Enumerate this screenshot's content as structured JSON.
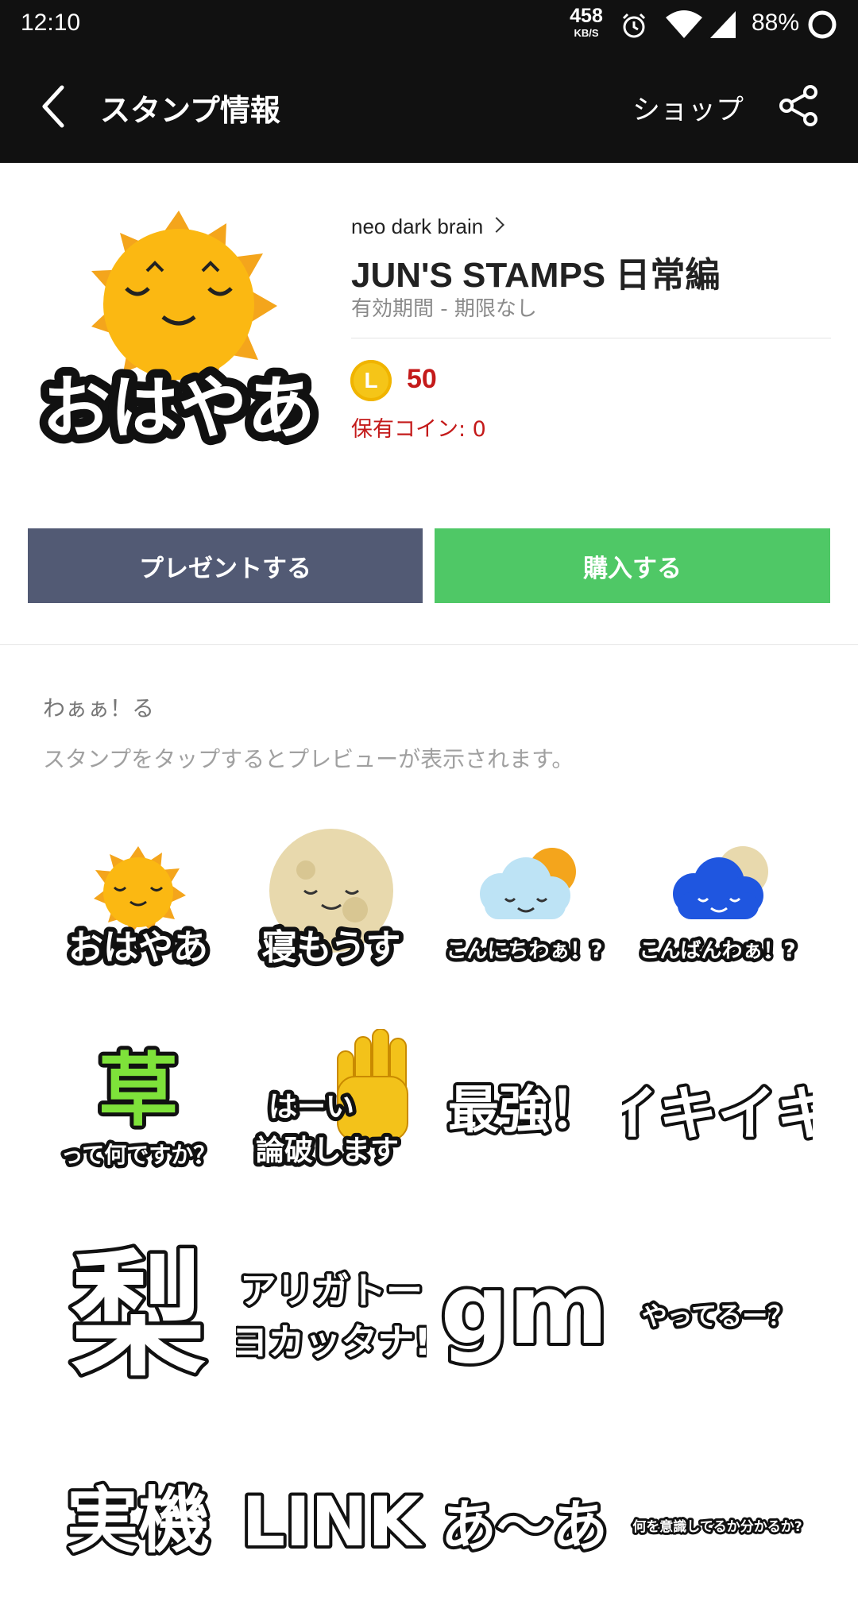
{
  "status_bar": {
    "time": "12:10",
    "net_speed_value": "458",
    "net_speed_unit": "KB/S",
    "battery_pct": "88%"
  },
  "app_bar": {
    "title": "スタンプ情報",
    "shop_label": "ショップ"
  },
  "product": {
    "author": "neo dark brain",
    "name": "JUN'S STAMPS 日常編",
    "validity": "有効期間 - 期限なし",
    "coin_letter": "L",
    "price": "50",
    "owned_coins": "保有コイン: 0",
    "thumbnail_text": "おはやあ"
  },
  "actions": {
    "present_label": "プレゼントする",
    "buy_label": "購入する"
  },
  "description": {
    "tagline": "わぁぁ！る",
    "hint": "スタンプをタップするとプレビューが表示されます。"
  },
  "stickers": [
    {
      "text": "おはやあ",
      "icon": "sun-icon"
    },
    {
      "text": "寝もうす",
      "icon": "moon-icon"
    },
    {
      "text": "こんにちわぁ！?",
      "icon": "cloud-sun-icon"
    },
    {
      "text": "こんばんわぁ！?",
      "icon": "cloud-moon-icon"
    },
    {
      "text": "草",
      "sub": "って何ですか？",
      "icon": "grass-text-icon"
    },
    {
      "text": "はーい",
      "sub": "論破します",
      "icon": "raised-hand-icon"
    },
    {
      "text": "最強！",
      "icon": "text-sticker-icon"
    },
    {
      "text": "イキイキ",
      "icon": "text-sticker-icon"
    },
    {
      "text": "梨",
      "icon": "text-sticker-icon"
    },
    {
      "text": "アリガトー",
      "sub": "ヨカッタナ!",
      "icon": "text-sticker-icon"
    },
    {
      "text": "gm",
      "icon": "text-sticker-icon"
    },
    {
      "text": "やってるー？",
      "icon": "text-sticker-icon"
    },
    {
      "text": "実機",
      "icon": "text-sticker-icon"
    },
    {
      "text": "LINK",
      "icon": "text-sticker-icon"
    },
    {
      "text": "あ〜あ",
      "icon": "text-sticker-icon"
    },
    {
      "text": "何を意識してるか分かるか?",
      "icon": "text-sticker-icon"
    }
  ]
}
